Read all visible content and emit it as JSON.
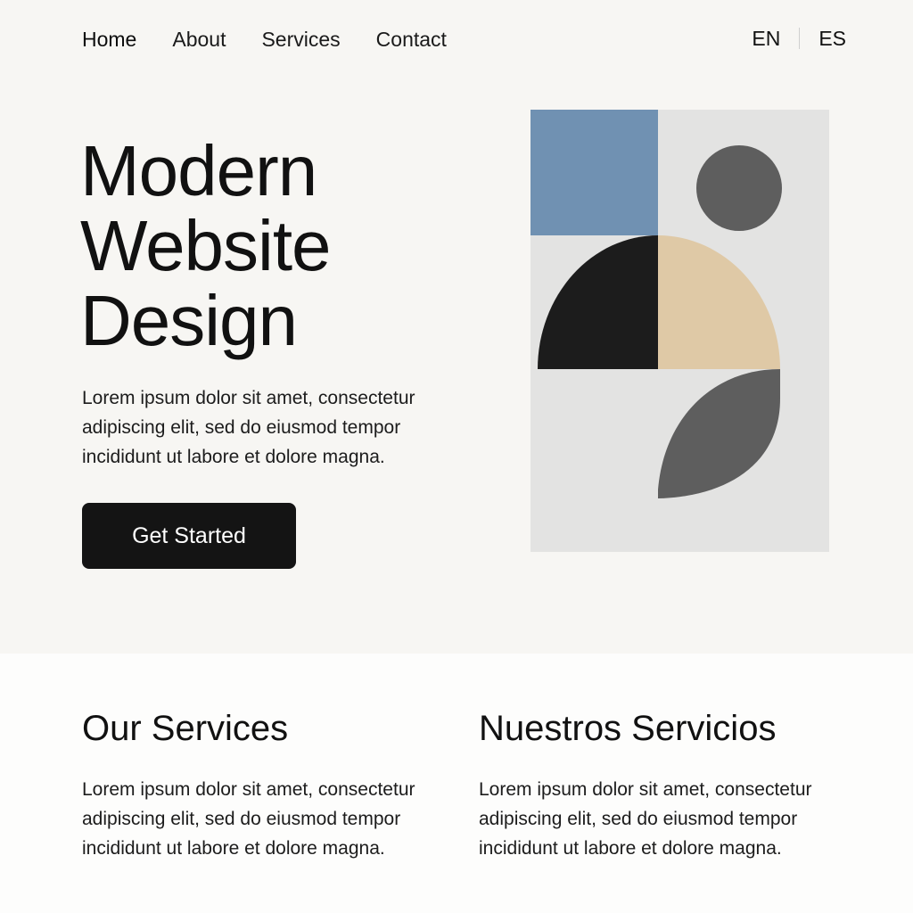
{
  "nav": {
    "items": [
      {
        "label": "Home"
      },
      {
        "label": "About"
      },
      {
        "label": "Services"
      },
      {
        "label": "Contact"
      }
    ],
    "languages": [
      "EN",
      "ES"
    ]
  },
  "hero": {
    "title_lines": [
      "Modern",
      "Website",
      "Design"
    ],
    "text": "Lorem ipsum dolor sit amet, consectetur adipiscing elit, sed do eiusmod tempor incididunt ut labore et dolore magna.",
    "cta_label": "Get Started"
  },
  "services": {
    "left": {
      "title": "Our Services",
      "text": "Lorem ipsum dolor sit amet, consectetur adipiscing elit, sed do eiusmod tempor incididunt ut labore et dolore magna."
    },
    "right": {
      "title": "Nuestros Servicios",
      "text": "Lorem ipsum dolor sit amet, consectetur adipiscing elit, sed do eiusmod tempor incididunt ut labore et dolore magna."
    }
  },
  "colors": {
    "background": "#f7f6f3",
    "button": "#141414",
    "art_blue": "#7091b2",
    "art_beige": "#dfc9a6",
    "art_black": "#1c1c1c",
    "art_gray": "#5e5e5e",
    "art_panel": "#e3e3e2"
  }
}
